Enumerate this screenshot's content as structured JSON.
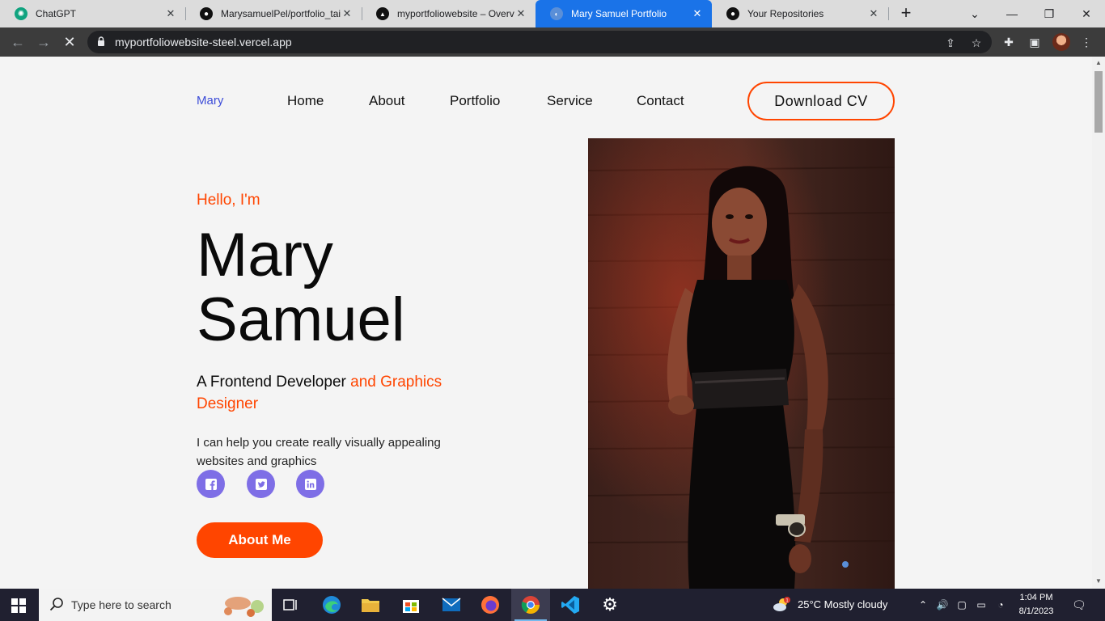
{
  "browser": {
    "tabs": [
      {
        "title": "ChatGPT",
        "active": false
      },
      {
        "title": "MarysamuelPel/portfolio_tail",
        "active": false
      },
      {
        "title": "myportfoliowebsite – Overvie",
        "active": false
      },
      {
        "title": "Mary Samuel Portfolio",
        "active": true
      },
      {
        "title": "Your Repositories",
        "active": false
      }
    ],
    "url": "myportfoliowebsite-steel.vercel.app"
  },
  "site": {
    "logo": "Mary",
    "nav": [
      "Home",
      "About",
      "Portfolio",
      "Service",
      "Contact"
    ],
    "cv_button": "Download CV",
    "hero": {
      "greeting": "Hello, I'm",
      "name_line1": "Mary",
      "name_line2": "Samuel",
      "role_plain": "A Frontend Developer",
      "role_accent": "and Graphics Designer",
      "description": "I can help you create really visually appealing websites and graphics",
      "social": [
        "facebook-icon",
        "twitter-icon",
        "linkedin-icon"
      ],
      "about_button": "About Me"
    },
    "colors": {
      "accent": "#ff4500",
      "social": "#7e6ee6",
      "logo": "#3b4bd8"
    }
  },
  "taskbar": {
    "search_placeholder": "Type here to search",
    "weather": "25°C  Mostly cloudy",
    "weather_badge": "1",
    "time": "1:04 PM",
    "date": "8/1/2023"
  }
}
